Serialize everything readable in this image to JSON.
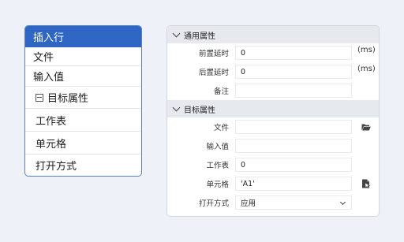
{
  "menu": {
    "header": "插入行",
    "items": [
      {
        "label": "文件"
      },
      {
        "label": "输入值"
      },
      {
        "label": "目标属性",
        "collapse": true
      },
      {
        "label": "工作表"
      },
      {
        "label": "单元格"
      },
      {
        "label": "打开方式"
      }
    ]
  },
  "props": {
    "general": {
      "title": "通用属性",
      "pre_delay": {
        "label": "前置延时",
        "value": "0",
        "unit": "(ms)"
      },
      "post_delay": {
        "label": "后置延时",
        "value": "0",
        "unit": "(ms)"
      },
      "note": {
        "label": "备注",
        "value": ""
      }
    },
    "target": {
      "title": "目标属性",
      "file": {
        "label": "文件",
        "value": "",
        "icon": "folder-open-icon"
      },
      "input_value": {
        "label": "输入值",
        "value": ""
      },
      "sheet": {
        "label": "工作表",
        "value": "0"
      },
      "cell": {
        "label": "单元格",
        "value": "'A1'",
        "icon": "cell-select-icon"
      },
      "open_mode": {
        "label": "打开方式",
        "value": "应用"
      }
    }
  }
}
